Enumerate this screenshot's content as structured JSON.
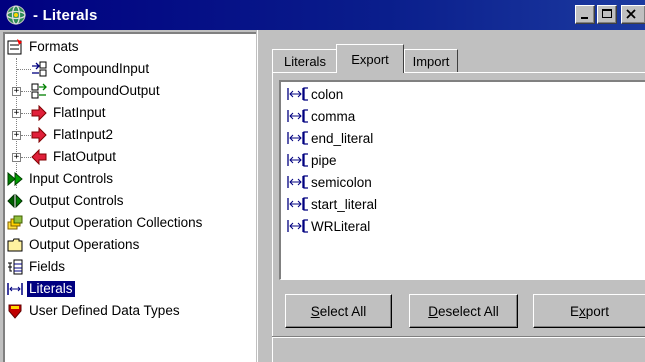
{
  "window": {
    "title": "- Literals",
    "icon": "app-globe-icon"
  },
  "tree": {
    "items": [
      {
        "label": "Formats",
        "icon": "formats-icon"
      },
      {
        "label": "CompoundInput",
        "icon": "compound-input-icon"
      },
      {
        "label": "CompoundOutput",
        "icon": "compound-output-icon"
      },
      {
        "label": "FlatInput",
        "icon": "flat-input-arrow-icon"
      },
      {
        "label": "FlatInput2",
        "icon": "flat-input-arrow-icon"
      },
      {
        "label": "FlatOutput",
        "icon": "flat-output-arrow-icon"
      },
      {
        "label": "Input Controls",
        "icon": "input-controls-icon"
      },
      {
        "label": "Output Controls",
        "icon": "output-controls-icon"
      },
      {
        "label": "Output Operation Collections",
        "icon": "operation-collections-icon"
      },
      {
        "label": "Output Operations",
        "icon": "folder-icon"
      },
      {
        "label": "Fields",
        "icon": "fields-icon"
      },
      {
        "label": "Literals",
        "icon": "literal-icon",
        "selected": true
      },
      {
        "label": "User Defined Data Types",
        "icon": "user-types-icon"
      }
    ]
  },
  "tabs": [
    {
      "label": "Literals",
      "active": false
    },
    {
      "label": "Export",
      "active": true
    },
    {
      "label": "Import",
      "active": false
    }
  ],
  "literals_list": {
    "items": [
      {
        "label": "colon"
      },
      {
        "label": "comma"
      },
      {
        "label": "end_literal"
      },
      {
        "label": "pipe"
      },
      {
        "label": "semicolon"
      },
      {
        "label": "start_literal"
      },
      {
        "label": "WRLiteral"
      }
    ]
  },
  "buttons": {
    "select_all": {
      "accel": "S",
      "rest": "elect All"
    },
    "deselect_all": {
      "accel": "D",
      "rest": "eselect All"
    },
    "export": {
      "pre": "E",
      "accel": "x",
      "rest": "port"
    }
  },
  "colors": {
    "titlebar": "#000080",
    "selection": "#000080",
    "face": "#c0c0c0"
  }
}
